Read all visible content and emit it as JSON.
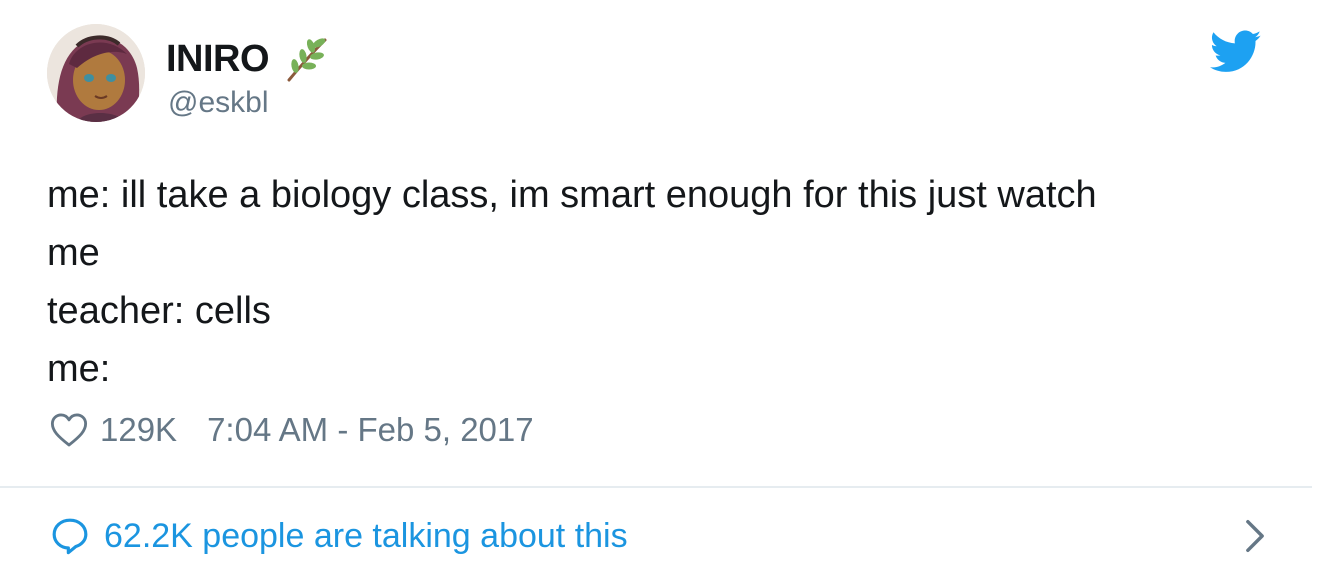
{
  "author": {
    "display_name": "INIRO",
    "handle": "@eskbl",
    "name_emoji": "herb-emoji"
  },
  "tweet": {
    "lines": [
      "me: ill take a biology class, im smart enough for this just watch",
      "me",
      "teacher: cells",
      "me:"
    ]
  },
  "meta": {
    "likes": "129K",
    "timestamp": "7:04 AM - Feb 5, 2017"
  },
  "footer": {
    "talking_text": "62.2K people are talking about this"
  },
  "icons": {
    "brand": "twitter-bird-icon",
    "like": "heart-icon",
    "talking": "speech-bubble-icon",
    "more": "chevron-right-icon"
  },
  "colors": {
    "brand_blue": "#1da1f2",
    "link_blue": "#1b95e0",
    "text": "#14171a",
    "secondary_text": "#657786",
    "divider": "#e6ecf0"
  }
}
